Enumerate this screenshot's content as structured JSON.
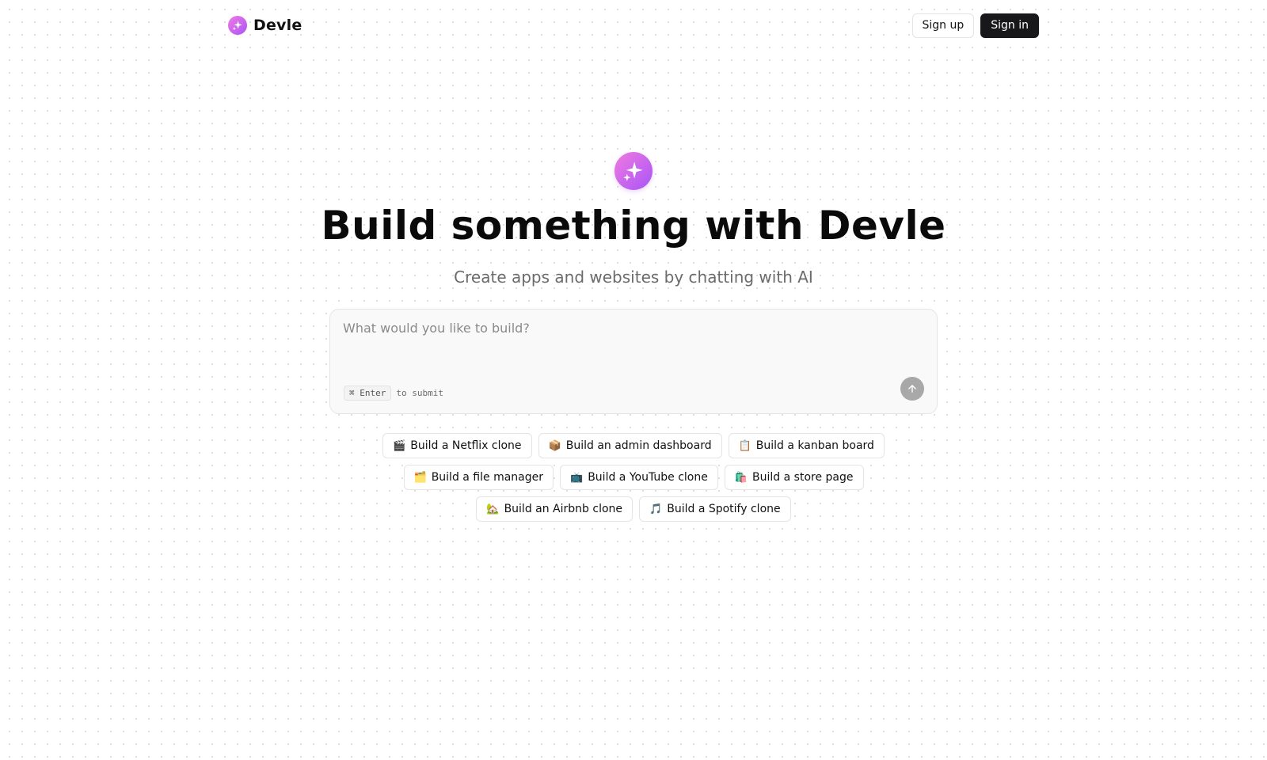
{
  "header": {
    "brand_name": "Devle",
    "sign_up_label": "Sign up",
    "sign_in_label": "Sign in",
    "logo_icon": "sparkles-icon"
  },
  "hero": {
    "icon": "sparkles-icon",
    "title": "Build something with Devle",
    "subtitle": "Create apps and websites by chatting with AI"
  },
  "prompt": {
    "placeholder": "What would you like to build?",
    "value": "",
    "shortcut_key": "⌘ Enter",
    "shortcut_hint": "to submit",
    "submit_icon": "arrow-up-icon"
  },
  "suggestions": [
    {
      "emoji": "🎬",
      "label": "Build a Netflix clone"
    },
    {
      "emoji": "📦",
      "label": "Build an admin dashboard"
    },
    {
      "emoji": "📋",
      "label": "Build a kanban board"
    },
    {
      "emoji": "🗂️",
      "label": "Build a file manager"
    },
    {
      "emoji": "📺",
      "label": "Build a YouTube clone"
    },
    {
      "emoji": "🛍️",
      "label": "Build a store page"
    },
    {
      "emoji": "🏡",
      "label": "Build an Airbnb clone"
    },
    {
      "emoji": "🎵",
      "label": "Build a Spotify clone"
    }
  ],
  "colors": {
    "accent_gradient_start": "#f17ae0",
    "accent_gradient_end": "#a855f7",
    "primary_button": "#18181b",
    "submit_button_disabled": "#a8a8a8"
  }
}
